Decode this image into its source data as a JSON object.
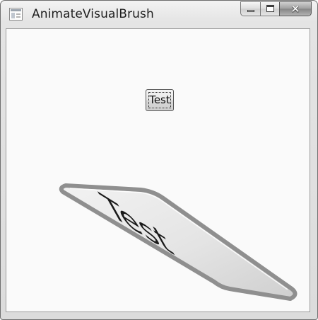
{
  "window": {
    "title": "AnimateVisualBrush",
    "icon": "app-window-icon",
    "controls": {
      "minimize_icon": "minimize-icon",
      "maximize_icon": "maximize-icon",
      "close_icon": "close-icon",
      "close_glyph": "✕"
    }
  },
  "content": {
    "button_label": "Test",
    "brush_text": "Test"
  }
}
